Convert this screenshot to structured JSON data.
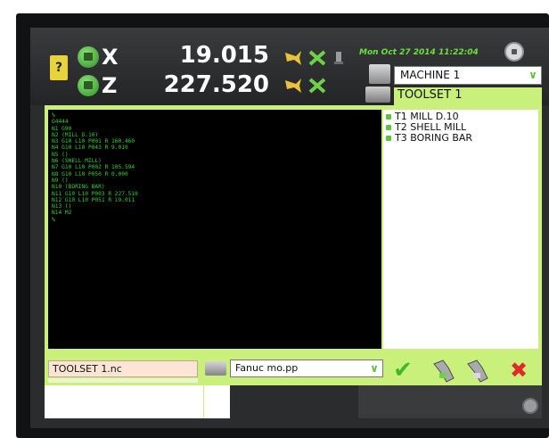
{
  "axes": {
    "x": {
      "label": "X",
      "value": "19.015"
    },
    "z": {
      "label": "Z",
      "value": "227.520"
    }
  },
  "datetime": "Mon Oct 27 2014 11:22:04",
  "machine": {
    "selected": "MACHINE 1"
  },
  "toolset": {
    "header": "TOOLSET 1"
  },
  "tools": [
    "T1 MILL D.10",
    "T2 SHELL MILL",
    "T3 BORING BAR"
  ],
  "program": [
    "%",
    "O4444",
    "N1 G90",
    "N2 (MILL D.10)",
    "N3 G10 L10 P001 R 160.460",
    "N4 G10 L10 P043 R 9.010",
    "N5 ()",
    "N6 (SHELL MILL)",
    "N7 G10 L10 P002 R 105.594",
    "N8 G10 L10 P050 R 0.000",
    "N9 ()",
    "N10 (BORING BAR)",
    "N11 G10 L10 P003 R 227.510",
    "N12 G10 L10 P051 R 19.011",
    "N13 ()",
    "N14 M2",
    "%"
  ],
  "file": {
    "name": "TOOLSET 1.nc"
  },
  "postprocessor": {
    "selected": "Fanuc mo.pp"
  },
  "doc_icon_glyph": "?",
  "dropdown_glyph": "∨",
  "confirm_glyph": "✔",
  "cancel_glyph": "✖",
  "colors": {
    "accent_green": "#c8f07a",
    "code_text": "#30d230",
    "datetime": "#69e23a",
    "cancel_red": "#e02a2a"
  },
  "icons": [
    "document-icon",
    "home-x-icon",
    "home-z-icon",
    "probe-icon",
    "measure-icon",
    "tool-icon",
    "gear-icon",
    "machine-icon",
    "toolset-icon",
    "folder-icon",
    "confirm-icon",
    "tool-holder-icon",
    "cancel-icon",
    "power-icon"
  ]
}
